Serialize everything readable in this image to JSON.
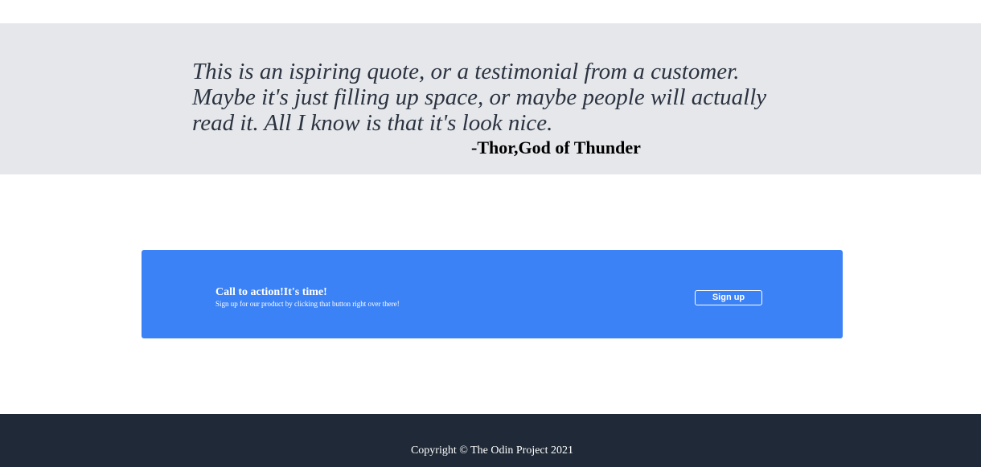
{
  "quote": {
    "text": "This is an ispiring quote, or a testimonial from a customer. Maybe it's just filling up space, or maybe people will actually read it. All I know is that it's look nice.",
    "author": "-Thor,God of Thunder"
  },
  "cta": {
    "title": "Call to action!It's time!",
    "subtitle": "Sign up for our product by clicking that button right over there!",
    "button_label": "Sign up"
  },
  "footer": {
    "copyright": "Copyright © The Odin Project 2021"
  },
  "colors": {
    "quote_background": "#e5e7eb",
    "cta_background": "#3b82f6",
    "footer_background": "#1f2937"
  }
}
